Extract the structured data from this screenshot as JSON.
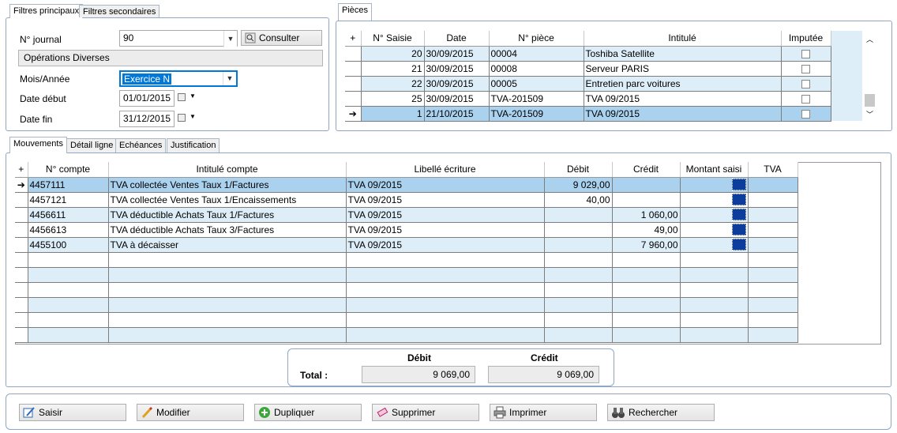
{
  "top_left_tabs": [
    "Filtres principaux",
    "Filtres secondaires"
  ],
  "filters": {
    "journal_label": "N° journal",
    "journal_value": "90",
    "consulter_label": "Consulter",
    "journal_name": "Opérations Diverses",
    "mois_label": "Mois/Année",
    "mois_value": "Exercice N",
    "date_debut_label": "Date début",
    "date_debut_value": "01/01/2015",
    "date_fin_label": "Date fin",
    "date_fin_value": "31/12/2015"
  },
  "pieces": {
    "tab": "Pièces",
    "headers": [
      "N° Saisie",
      "Date",
      "N° pièce",
      "Intitulé",
      "Imputée"
    ],
    "rows": [
      {
        "saisie": "20",
        "date": "30/09/2015",
        "piece": "00004",
        "intitule": "Toshiba Satellite"
      },
      {
        "saisie": "21",
        "date": "30/09/2015",
        "piece": "00008",
        "intitule": "Serveur PARIS"
      },
      {
        "saisie": "22",
        "date": "30/09/2015",
        "piece": "00005",
        "intitule": "Entretien parc voitures"
      },
      {
        "saisie": "25",
        "date": "30/09/2015",
        "piece": "TVA-201509",
        "intitule": "TVA 09/2015"
      },
      {
        "saisie": "1",
        "date": "21/10/2015",
        "piece": "TVA-201509",
        "intitule": "TVA 09/2015"
      }
    ]
  },
  "mid_tabs": [
    "Mouvements",
    "Détail ligne",
    "Echéances",
    "Justification"
  ],
  "mouvements": {
    "headers": [
      "N° compte",
      "Intitulé compte",
      "Libellé écriture",
      "Débit",
      "Crédit",
      "Montant saisi",
      "TVA"
    ],
    "rows": [
      {
        "compte": "4457111",
        "intitule": "TVA collectée Ventes Taux 1/Factures",
        "libelle": "TVA 09/2015",
        "debit": "9 029,00",
        "credit": ""
      },
      {
        "compte": "4457121",
        "intitule": "TVA collectée Ventes Taux 1/Encaissements",
        "libelle": "TVA 09/2015",
        "debit": "40,00",
        "credit": ""
      },
      {
        "compte": "4456611",
        "intitule": "TVA déductible Achats Taux 1/Factures",
        "libelle": "TVA 09/2015",
        "debit": "",
        "credit": "1 060,00"
      },
      {
        "compte": "4456613",
        "intitule": "TVA déductible Achats Taux 3/Factures",
        "libelle": "TVA 09/2015",
        "debit": "",
        "credit": "49,00"
      },
      {
        "compte": "4455100",
        "intitule": "TVA à décaisser",
        "libelle": "TVA 09/2015",
        "debit": "",
        "credit": "7 960,00"
      }
    ]
  },
  "totals": {
    "debit_label": "Débit",
    "credit_label": "Crédit",
    "total_label": "Total :",
    "debit": "9 069,00",
    "credit": "9 069,00"
  },
  "actions": [
    "Saisir",
    "Modifier",
    "Dupliquer",
    "Supprimer",
    "Imprimer",
    "Rechercher"
  ],
  "colors": {
    "selected_row": "#aad1ee",
    "alt_row": "#ddeef8",
    "focus": "#0078d7"
  }
}
